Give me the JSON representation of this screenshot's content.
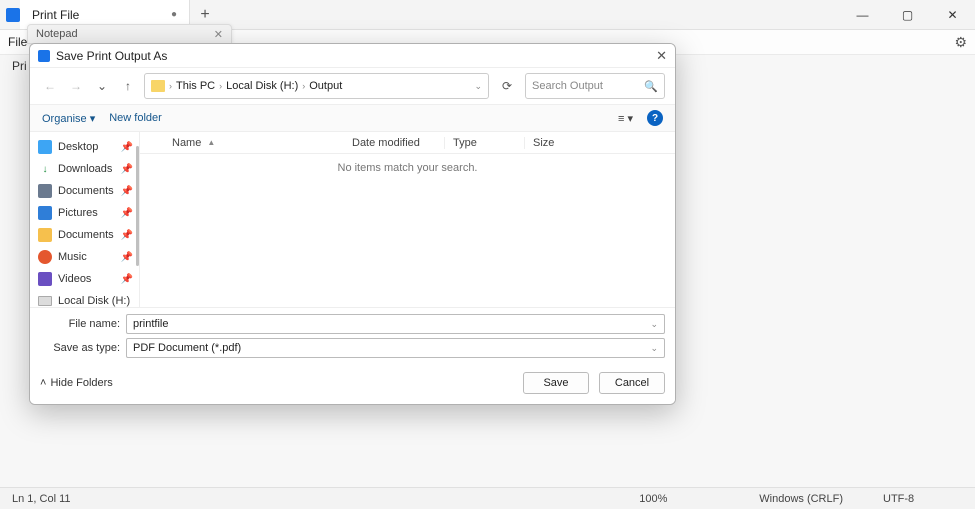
{
  "window": {
    "tab_title": "Print File",
    "bg_tab": "Notepad",
    "file_menu": "File",
    "bg_line": "Pri"
  },
  "dialog": {
    "title": "Save Print Output As",
    "path": {
      "root": "This PC",
      "drive": "Local Disk (H:)",
      "folder": "Output"
    },
    "search_placeholder": "Search Output",
    "organise": "Organise",
    "newfolder": "New folder",
    "columns": {
      "name": "Name",
      "date": "Date modified",
      "type": "Type",
      "size": "Size"
    },
    "empty": "No items match your search.",
    "sidebar": [
      {
        "label": "Desktop",
        "iconClass": "i-desk",
        "pin": true
      },
      {
        "label": "Downloads",
        "iconClass": "i-dl",
        "pin": true,
        "glyph": "↓"
      },
      {
        "label": "Documents",
        "iconClass": "i-doc",
        "pin": true
      },
      {
        "label": "Pictures",
        "iconClass": "i-pic",
        "pin": true
      },
      {
        "label": "Documents",
        "iconClass": "i-fold",
        "pin": true
      },
      {
        "label": "Music",
        "iconClass": "i-music",
        "pin": true
      },
      {
        "label": "Videos",
        "iconClass": "i-vid",
        "pin": true
      },
      {
        "label": "Local Disk (H:)",
        "iconClass": "i-disk",
        "pin": false
      }
    ],
    "filename_label": "File name:",
    "filename_value": "printfile",
    "savetype_label": "Save as type:",
    "savetype_value": "PDF Document (*.pdf)",
    "hide_folders": "Hide Folders",
    "save": "Save",
    "cancel": "Cancel"
  },
  "status": {
    "pos": "Ln 1, Col 11",
    "zoom": "100%",
    "eol": "Windows (CRLF)",
    "enc": "UTF-8"
  }
}
